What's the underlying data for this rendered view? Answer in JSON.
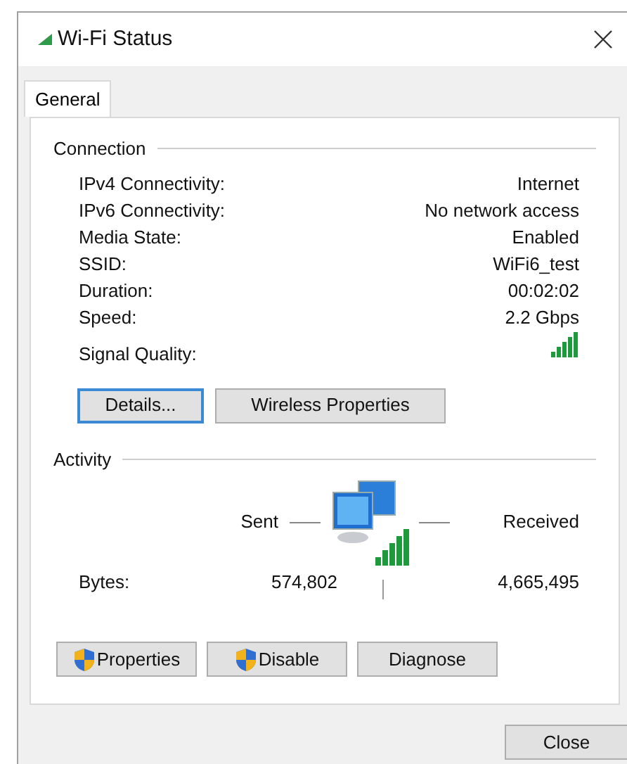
{
  "window": {
    "title": "Wi-Fi Status"
  },
  "tabs": [
    {
      "label": "General",
      "selected": true
    }
  ],
  "connection": {
    "heading": "Connection",
    "rows": [
      {
        "kind": "text",
        "label": "IPv4 Connectivity:",
        "value": "Internet"
      },
      {
        "kind": "text",
        "label": "IPv6 Connectivity:",
        "value": "No network access"
      },
      {
        "kind": "text",
        "label": "Media State:",
        "value": "Enabled"
      },
      {
        "kind": "text",
        "label": "SSID:",
        "value": "WiFi6_test"
      },
      {
        "kind": "text",
        "label": "Duration:",
        "value": "00:02:02"
      },
      {
        "kind": "text",
        "label": "Speed:",
        "value": "2.2 Gbps"
      },
      {
        "kind": "signal",
        "label": "Signal Quality:"
      }
    ],
    "buttons": [
      {
        "label": "Details...",
        "focused": true
      },
      {
        "label": "Wireless Properties",
        "focused": false
      }
    ]
  },
  "activity": {
    "heading": "Activity",
    "sent_label": "Sent",
    "received_label": "Received",
    "bytes_label": "Bytes:",
    "sent": "574,802",
    "received": "4,665,495"
  },
  "action_buttons": [
    {
      "label": "Properties",
      "shield": true
    },
    {
      "label": "Disable",
      "shield": true
    },
    {
      "label": "Diagnose",
      "shield": false
    }
  ],
  "footer_buttons": [
    "Close"
  ]
}
